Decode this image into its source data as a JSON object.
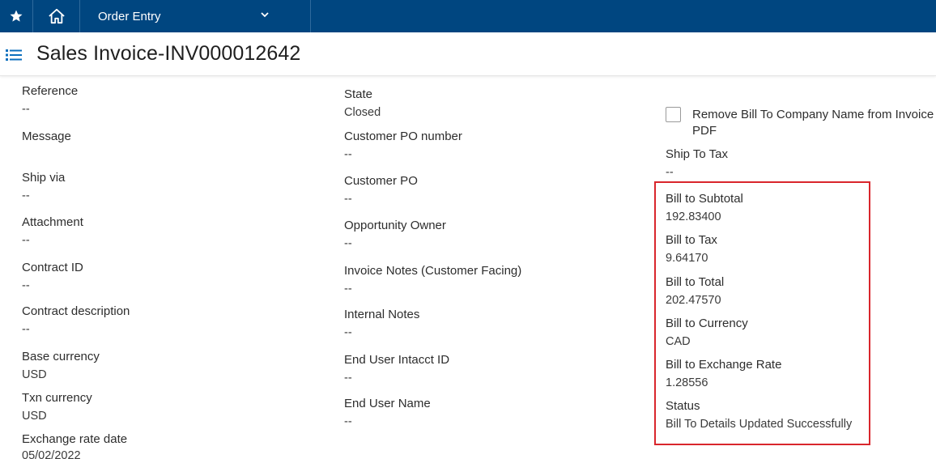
{
  "nav": {
    "module_label": "Order Entry"
  },
  "header": {
    "title": "Sales Invoice-INV000012642"
  },
  "col1": [
    {
      "label": "Reference",
      "value": "--"
    },
    {
      "label": "Message",
      "value": ""
    },
    {
      "label": "Ship via",
      "value": "--"
    },
    {
      "label": "Attachment",
      "value": "--"
    },
    {
      "label": "Contract ID",
      "value": "--"
    },
    {
      "label": "Contract description",
      "value": "--"
    },
    {
      "label": "Base currency",
      "value": "USD"
    },
    {
      "label": "Txn currency",
      "value": "USD"
    },
    {
      "label": "Exchange rate date",
      "value": "05/02/2022"
    }
  ],
  "col2": [
    {
      "label": "State",
      "value": "Closed"
    },
    {
      "label": "Customer PO number",
      "value": "--"
    },
    {
      "label": "Customer PO",
      "value": "--"
    },
    {
      "label": "Opportunity Owner",
      "value": "--"
    },
    {
      "label": "Invoice Notes (Customer Facing)",
      "value": "--"
    },
    {
      "label": "Internal Notes",
      "value": "--"
    },
    {
      "label": "End User Intacct ID",
      "value": "--"
    },
    {
      "label": "End User Name",
      "value": "--"
    }
  ],
  "col3": {
    "checkbox_label": "Remove Bill To Company Name from Invoice PDF",
    "checkbox_checked": false,
    "fields": [
      {
        "label": "Ship To Tax",
        "value": "--"
      },
      {
        "label": "Bill to Subtotal",
        "value": "192.83400"
      },
      {
        "label": "Bill to Tax",
        "value": "9.64170"
      },
      {
        "label": "Bill to Total",
        "value": "202.47570"
      },
      {
        "label": "Bill to Currency",
        "value": "CAD"
      },
      {
        "label": "Bill to Exchange Rate",
        "value": "1.28556"
      },
      {
        "label": "Status",
        "value": "Bill To Details Updated Successfully"
      }
    ]
  },
  "colors": {
    "nav_bg": "#004680",
    "highlight": "#d9262c",
    "menu_icon": "#0a6ebd"
  }
}
